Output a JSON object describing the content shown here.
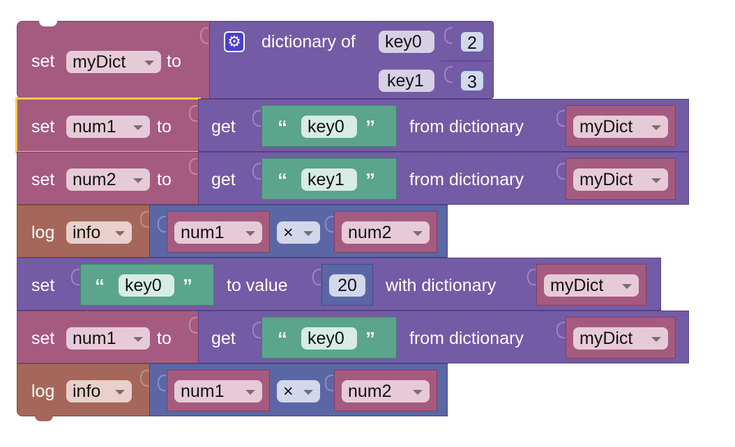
{
  "blocks": {
    "set_mydict": {
      "set": "set",
      "var": "myDict",
      "to": "to"
    },
    "dict_create": {
      "title": "dictionary of",
      "key0": "key0",
      "val0": "2",
      "key1": "key1",
      "val1": "3"
    },
    "set_num1_a": {
      "set": "set",
      "var": "num1",
      "to": "to",
      "get": "get",
      "open_quote": "“",
      "key": "key0",
      "close_quote": "”",
      "from": "from dictionary",
      "dict": "myDict"
    },
    "set_num2": {
      "set": "set",
      "var": "num2",
      "to": "to",
      "get": "get",
      "open_quote": "“",
      "key": "key1",
      "close_quote": "”",
      "from": "from dictionary",
      "dict": "myDict"
    },
    "log_a": {
      "log": "log",
      "level": "info",
      "a": "num1",
      "op": "×",
      "b": "num2"
    },
    "set_value": {
      "set": "set",
      "open_quote": "“",
      "key": "key0",
      "close_quote": "”",
      "to_value": "to value",
      "num": "20",
      "with": "with dictionary",
      "dict": "myDict"
    },
    "set_num1_b": {
      "set": "set",
      "var": "num1",
      "to": "to",
      "get": "get",
      "open_quote": "“",
      "key": "key0",
      "close_quote": "”",
      "from": "from dictionary",
      "dict": "myDict"
    },
    "log_b": {
      "log": "log",
      "level": "info",
      "a": "num1",
      "op": "×",
      "b": "num2"
    }
  },
  "icons": {
    "mutator": "gear-icon",
    "dropdown": "chevron-down-icon"
  },
  "colors": {
    "variables": "#A55B80",
    "dictionaries": "#745BA5",
    "logging": "#A5675B",
    "math": "#5B67A5",
    "text": "#5BA58C",
    "selection": "#F2C94C"
  }
}
